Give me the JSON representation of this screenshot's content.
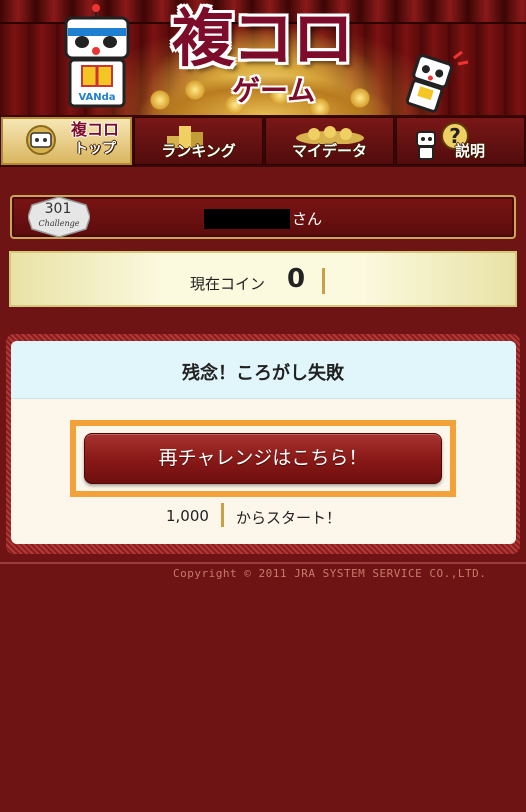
{
  "header": {
    "logo_main": "複コロ",
    "logo_sub": "ゲーム",
    "mascot_left_text": "VANda"
  },
  "nav": {
    "tabs": [
      {
        "label": "複コロ\nトップ",
        "icon": "mascot-face-icon",
        "active": true
      },
      {
        "label": "ランキング",
        "icon": "podium-icon",
        "active": false
      },
      {
        "label": "マイデータ",
        "icon": "coin-pile-icon",
        "active": false
      },
      {
        "label": "説明",
        "icon": "question-icon",
        "active": false
      }
    ]
  },
  "user": {
    "badge_number": "301",
    "badge_label": "Challenge",
    "name_suffix": "さん"
  },
  "coins": {
    "label": "現在コイン",
    "value": "0"
  },
  "result": {
    "title": "残念！ころがし失敗",
    "retry_button": "再チャレンジはこちら！",
    "start_amount": "1,000",
    "start_text": "からスタート！"
  },
  "footer": {
    "copyright": "Copyright © 2011 JRA SYSTEM SERVICE CO.,LTD."
  },
  "colors": {
    "background": "#6e1414",
    "button": "#8a1a18",
    "highlight": "#f3a23a",
    "panel_head": "#e1f6fb"
  }
}
